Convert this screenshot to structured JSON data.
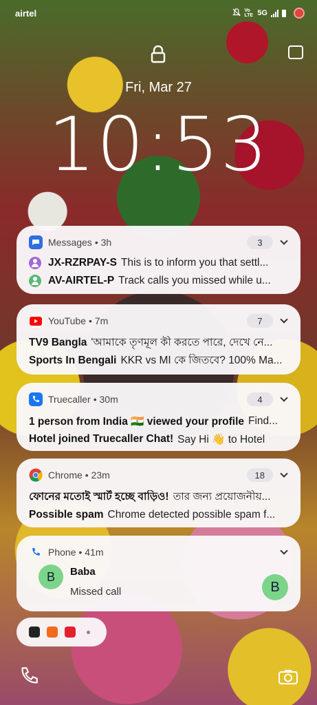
{
  "status": {
    "carrier": "airtel",
    "network": "5G",
    "volte": "Vo LTE"
  },
  "lockscreen": {
    "date": "Fri, Mar 27",
    "time": "10:53"
  },
  "notifications": {
    "messages": {
      "app": "Messages",
      "age": "• 3h",
      "count": "3",
      "items": [
        {
          "sender": "JX-RZRPAY-S",
          "text": "This is to inform you that settl..."
        },
        {
          "sender": "AV-AIRTEL-P",
          "text": "Track calls you missed while u..."
        }
      ]
    },
    "youtube": {
      "app": "YouTube",
      "age": "• 7m",
      "count": "7",
      "items": [
        {
          "sender": "TV9 Bangla",
          "text": "'আমাকে তৃণমূল কী করতে পারে, দেখে নে..."
        },
        {
          "sender": "Sports In Bengali",
          "text": "KKR vs MI কে জিতবে? 100% Ma..."
        }
      ]
    },
    "truecaller": {
      "app": "Truecaller",
      "age": "• 30m",
      "count": "4",
      "items": [
        {
          "sender": "1 person from India 🇮🇳 viewed your profile",
          "text": "Find..."
        },
        {
          "sender": "Hotel joined Truecaller Chat!",
          "text": "Say Hi 👋 to Hotel"
        }
      ]
    },
    "chrome": {
      "app": "Chrome",
      "age": "• 23m",
      "count": "18",
      "items": [
        {
          "sender": "ফোনের মতোই স্মার্ট হচ্ছে বাড়িও!",
          "text": "তার জন্য প্রয়োজনীয়..."
        },
        {
          "sender": "Possible spam",
          "text": "Chrome detected possible spam f..."
        }
      ]
    },
    "phone": {
      "app": "Phone",
      "age": "• 41m",
      "caller": "Baba",
      "caller_initial": "B",
      "detail": "Missed call"
    }
  },
  "colors": {
    "messages": "#3b82f6",
    "youtube": "#ff0000",
    "truecaller": "#1877f2",
    "avatar_green": "#7cd48a",
    "person_purple": "#a06ad4",
    "person_green": "#5bb874"
  }
}
